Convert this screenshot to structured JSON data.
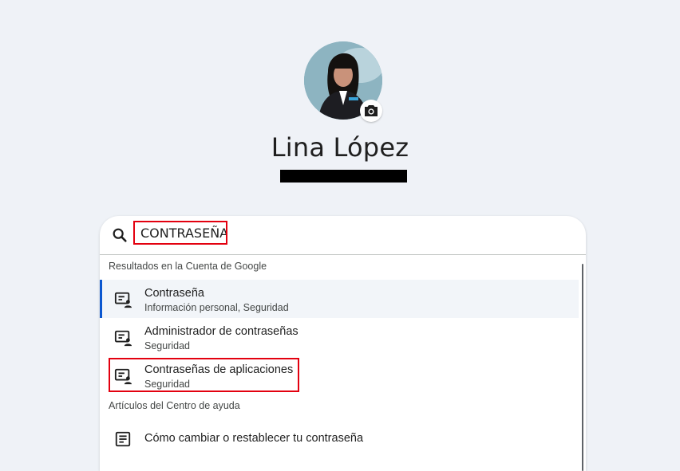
{
  "profile": {
    "name": "Lina López",
    "avatar_icon": "profile-photo",
    "camera_icon": "camera-icon"
  },
  "search": {
    "value": "CONTRASEÑA",
    "icon": "search-icon"
  },
  "account_results": {
    "header": "Resultados en la Cuenta de Google",
    "items": [
      {
        "title": "Contraseña",
        "subtitle": "Información personal, Seguridad"
      },
      {
        "title": "Administrador de contraseñas",
        "subtitle": "Seguridad"
      },
      {
        "title": "Contraseñas de aplicaciones",
        "subtitle": "Seguridad"
      }
    ]
  },
  "help_results": {
    "header": "Artículos del Centro de ayuda",
    "items": [
      {
        "title": "Cómo cambiar o restablecer tu contraseña"
      }
    ]
  },
  "colors": {
    "background": "#eff2f7",
    "highlight": "#e3000f",
    "accent": "#0b57d0"
  }
}
